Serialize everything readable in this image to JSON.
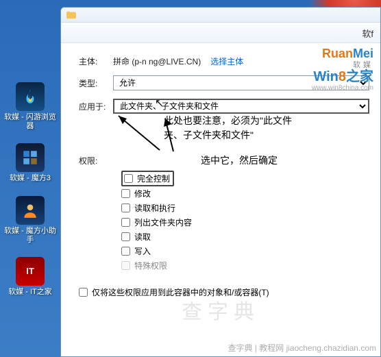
{
  "desktop": {
    "items": [
      {
        "label": "软媒 - 闪游浏览器"
      },
      {
        "label": "软媒 - 魔方3"
      },
      {
        "label": "软媒 - 魔方小助手"
      },
      {
        "label": "软媒 - IT之家"
      }
    ],
    "it_text": "IT"
  },
  "explorer": {
    "title_partial": "软f"
  },
  "form": {
    "principal_label": "主体:",
    "principal_value": "拼命 (p-n   ng@LIVE.CN)",
    "select_principal": "选择主体",
    "type_label": "类型:",
    "type_value": "允许",
    "applies_label": "应用于:",
    "applies_value": "此文件夹、子文件夹和文件"
  },
  "brand": {
    "ruanmei": "RuanMei",
    "ruan_soft": "软媒",
    "win8": "Win8之家",
    "url": "www.win8china.com"
  },
  "annotations": {
    "applies_note_1": "此处也要注意，必须为\"此文件",
    "applies_note_2": "夹、子文件夹和文件\"",
    "perm_note": "选中它，然后确定"
  },
  "permissions": {
    "section_label": "权限:",
    "items": [
      "完全控制",
      "修改",
      "读取和执行",
      "列出文件夹内容",
      "读取",
      "写入",
      "特殊权限"
    ]
  },
  "apply_only": {
    "label": "仅将这些权限应用到此容器中的对象和/或容器(T)"
  },
  "watermarks": {
    "center": "查字典",
    "bottom_right": "查字典 | 教程网 jiaocheng.chazidian.com"
  }
}
